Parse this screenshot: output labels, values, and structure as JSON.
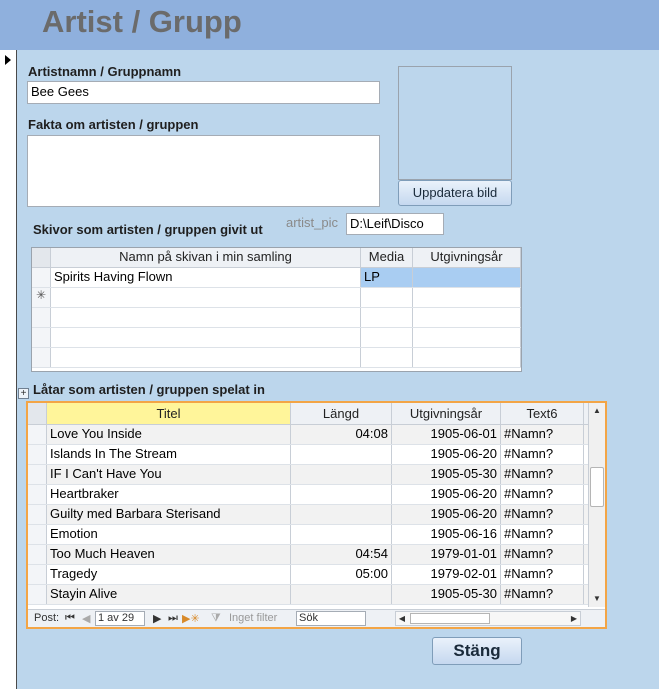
{
  "header": {
    "title": "Artist / Grupp"
  },
  "form": {
    "artist_name_label": "Artistnamn / Gruppnamn",
    "artist_name_value": "Bee Gees",
    "facts_label": "Fakta om artisten / gruppen",
    "facts_value": "",
    "update_image_button": "Uppdatera bild",
    "albums_label": "Skivor som artisten / gruppen givit ut",
    "artist_pic_label": "artist_pic",
    "artist_pic_value": "D:\\Leif\\Disco",
    "songs_label": "Låtar som artisten / gruppen spelat in",
    "close_button": "Stäng"
  },
  "albums": {
    "headers": [
      "Namn på skivan i min samling",
      "Media",
      "Utgivningsår"
    ],
    "rows": [
      {
        "name": "Spirits Having Flown",
        "media": "LP",
        "year": ""
      }
    ],
    "new_row_marker": "✳"
  },
  "songs": {
    "headers": [
      "Titel",
      "Längd",
      "Utgivningsår",
      "Text6"
    ],
    "rows": [
      {
        "title": "Love You Inside",
        "length": "04:08",
        "year": "1905-06-01",
        "text6": "#Namn?"
      },
      {
        "title": "Islands In The Stream",
        "length": "",
        "year": "1905-06-20",
        "text6": "#Namn?"
      },
      {
        "title": "IF I Can't Have You",
        "length": "",
        "year": "1905-05-30",
        "text6": "#Namn?"
      },
      {
        "title": "Heartbraker",
        "length": "",
        "year": "1905-06-20",
        "text6": "#Namn?"
      },
      {
        "title": "Guilty med Barbara Sterisand",
        "length": "",
        "year": "1905-06-20",
        "text6": "#Namn?"
      },
      {
        "title": "Emotion",
        "length": "",
        "year": "1905-06-16",
        "text6": "#Namn?"
      },
      {
        "title": "Too Much Heaven",
        "length": "04:54",
        "year": "1979-01-01",
        "text6": "#Namn?"
      },
      {
        "title": "Tragedy",
        "length": "05:00",
        "year": "1979-02-01",
        "text6": "#Namn?"
      },
      {
        "title": "Stayin Alive",
        "length": "",
        "year": "1905-05-30",
        "text6": "#Namn?"
      }
    ],
    "navigation": {
      "post_label": "Post:",
      "record_position": "1 av 29",
      "filter_label": "Inget filter",
      "search_placeholder": "Sök"
    }
  }
}
